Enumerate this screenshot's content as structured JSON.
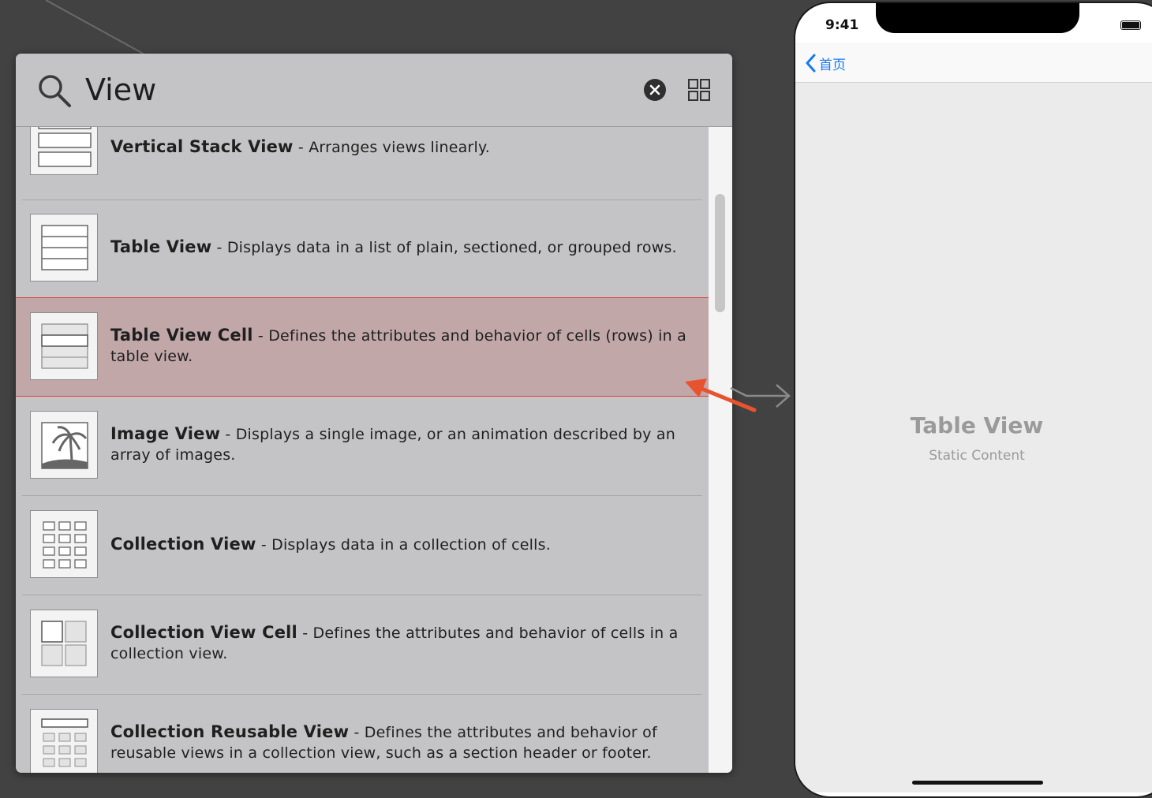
{
  "library": {
    "search_query": "View",
    "items": [
      {
        "title": "Vertical Stack View",
        "description": " - Arranges views linearly.",
        "icon": "vertical-stack-icon"
      },
      {
        "title": "Table View",
        "description": " - Displays data in a list of plain, sectioned, or grouped rows.",
        "icon": "table-view-icon"
      },
      {
        "title": "Table View Cell",
        "description": " - Defines the attributes and behavior of cells (rows) in a table view.",
        "icon": "table-view-cell-icon",
        "selected": true
      },
      {
        "title": "Image View",
        "description": " - Displays a single image, or an animation described by an array of images.",
        "icon": "image-view-icon"
      },
      {
        "title": "Collection View",
        "description": " - Displays data in a collection of cells.",
        "icon": "collection-view-icon"
      },
      {
        "title": "Collection View Cell",
        "description": " - Defines the attributes and behavior of cells in a collection view.",
        "icon": "collection-view-cell-icon"
      },
      {
        "title": "Collection Reusable View",
        "description": " - Defines the attributes and behavior of reusable views in a collection view, such as a section header or footer.",
        "icon": "collection-reusable-view-icon"
      }
    ]
  },
  "phone": {
    "status_time": "9:41",
    "back_label": "首页",
    "content_title": "Table View",
    "content_subtitle": "Static Content"
  },
  "colors": {
    "selection_fill": "#c2a7a9",
    "selection_border": "#d9443a",
    "annotation_arrow": "#e8532f",
    "ios_blue": "#1878f3"
  }
}
